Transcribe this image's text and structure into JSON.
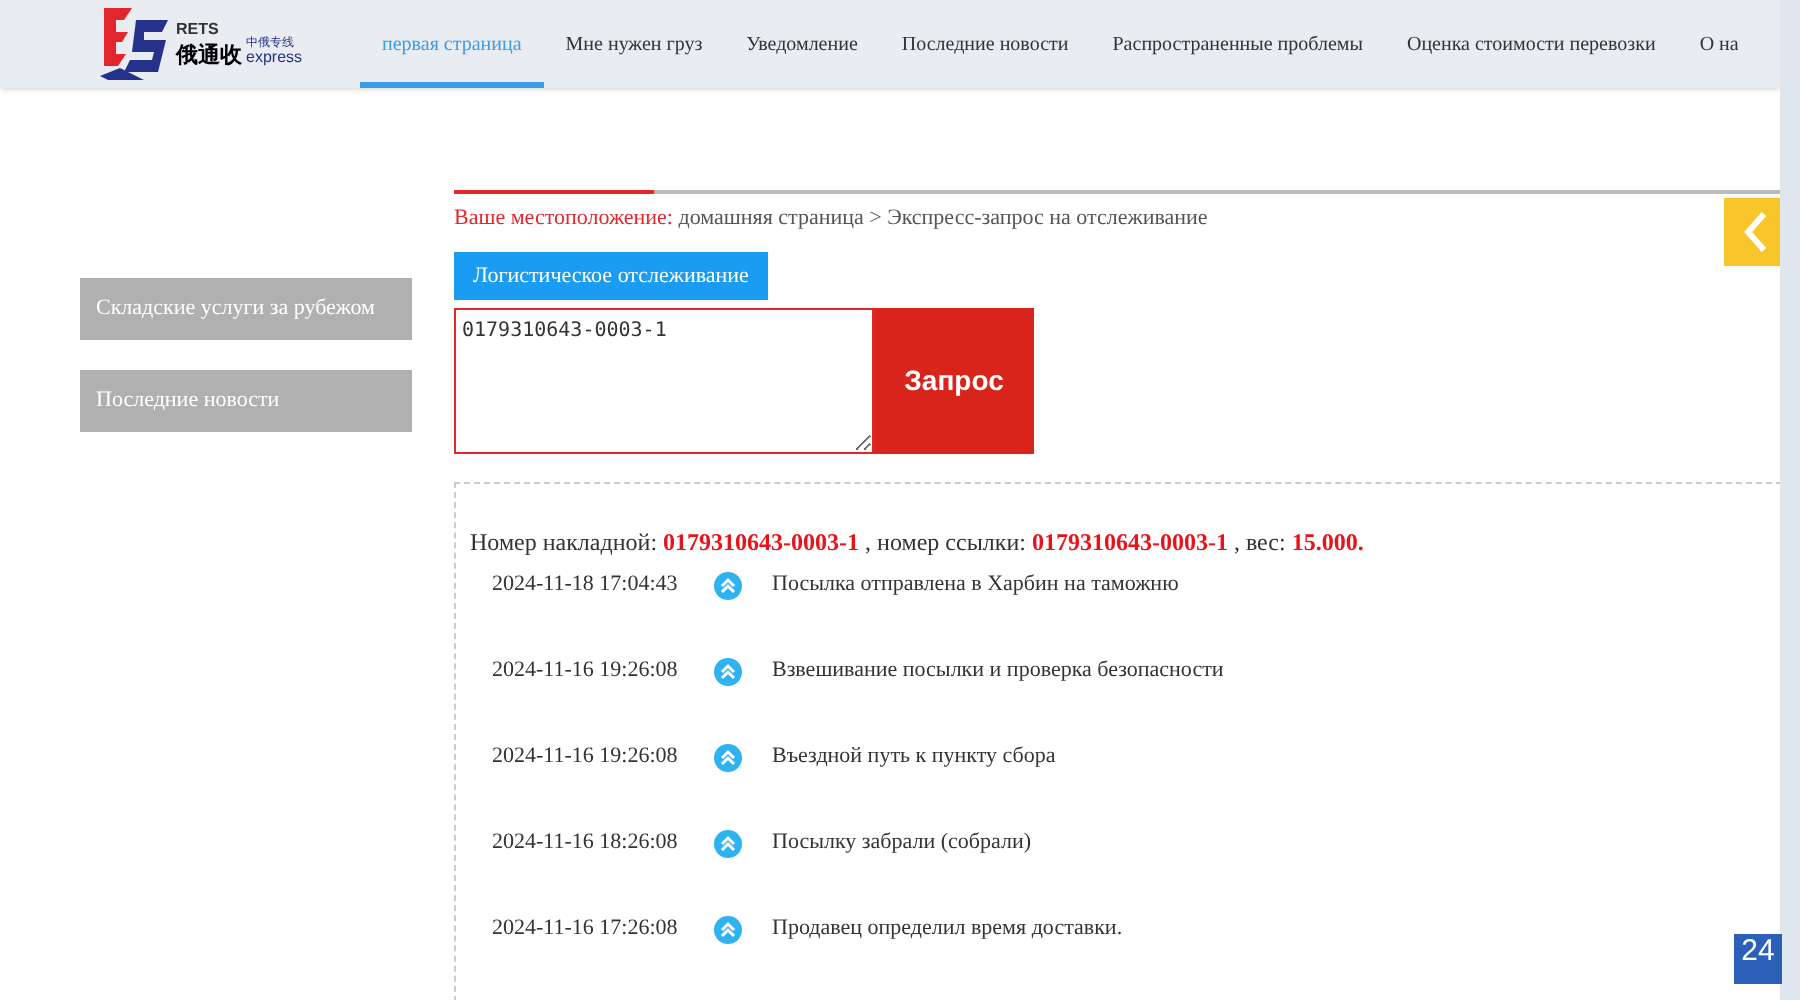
{
  "logo": {
    "brand": "RETS",
    "name": "俄通收",
    "subtitle": "中俄专线",
    "tagline": "express"
  },
  "nav": [
    {
      "label": "первая страница",
      "selected": true
    },
    {
      "label": "Мне нужен груз",
      "selected": false
    },
    {
      "label": "Уведомление",
      "selected": false
    },
    {
      "label": "Последние новости",
      "selected": false
    },
    {
      "label": "Распространенные проблемы",
      "selected": false
    },
    {
      "label": "Оценка стоимости перевозки",
      "selected": false
    },
    {
      "label": "О на",
      "selected": false
    }
  ],
  "sidebar": {
    "items": [
      "Складские услуги за рубежом",
      "Последние новости"
    ]
  },
  "breadcrumb": {
    "label": "Ваше местоположение:",
    "path": "домашняя страница > Экспресс-запрос на отслеживание"
  },
  "tracking_tab": "Логистическое отслеживание",
  "query": {
    "value": "0179310643-0003-1",
    "button": "Запрос"
  },
  "summary": "Номер накладной: **0179310643-0003-1** , номер ссылки: **0179310643-0003-1** , вес: **15.000.**",
  "events": [
    {
      "time": "2024-11-18 17:04:43",
      "text": "Посылка отправлена в Харбин на таможню"
    },
    {
      "time": "2024-11-16 19:26:08",
      "text": "Взвешивание посылки и проверка безопасности"
    },
    {
      "time": "2024-11-16 19:26:08",
      "text": "Въездной путь к пункту сбора"
    },
    {
      "time": "2024-11-16 18:26:08",
      "text": "Посылку забрали (собрали)"
    },
    {
      "time": "2024-11-16 17:26:08",
      "text": "Продавец определил время доставки."
    }
  ],
  "badge": "24"
}
